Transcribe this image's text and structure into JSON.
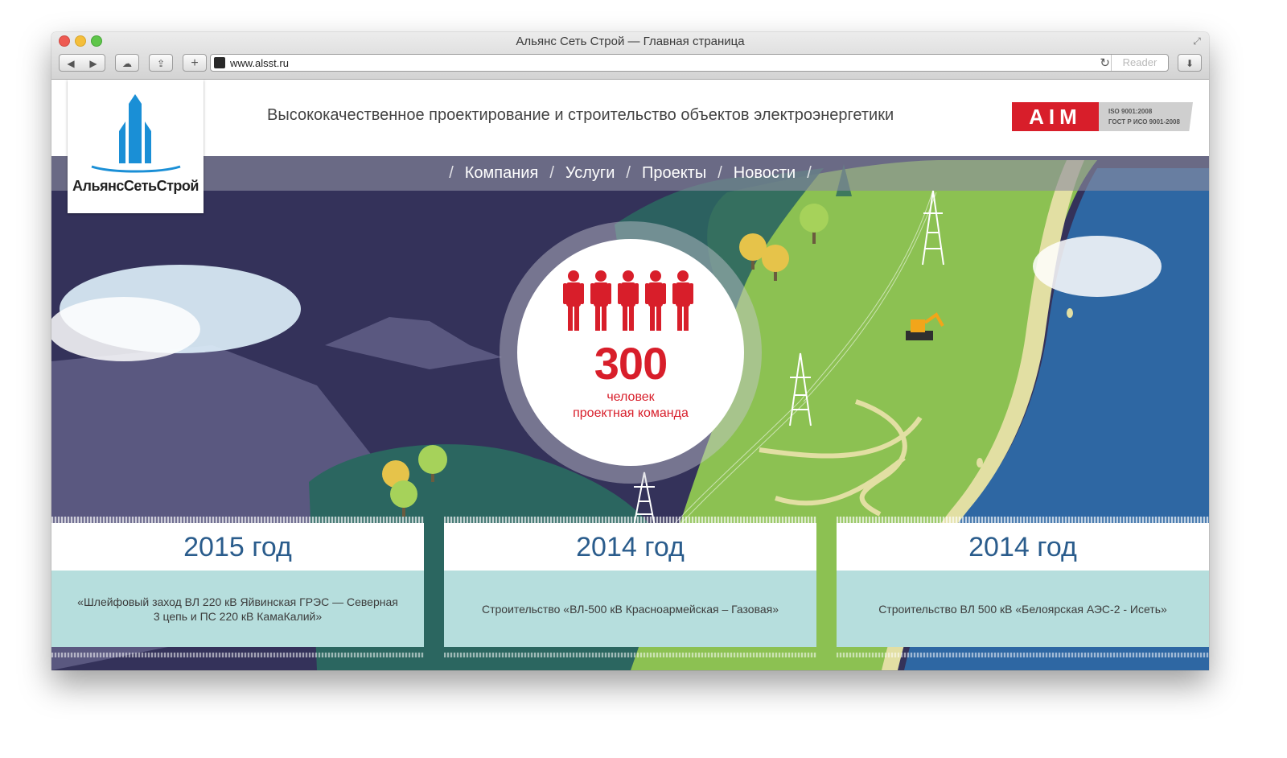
{
  "browser": {
    "window_title": "Альянс Сеть Строй — Главная страница",
    "url": "www.alsst.ru",
    "reader_label": "Reader",
    "back_glyph": "◀",
    "forward_glyph": "▶",
    "cloud_glyph": "☁",
    "share_glyph": "⇪",
    "new_tab_glyph": "+",
    "reload_glyph": "↻",
    "download_glyph": "⬇",
    "fullscreen_glyph": "⤢"
  },
  "header": {
    "logo_text": "АльянсСетьСтрой",
    "tagline": "Высококачественное проектирование и строительство объектов электроэнергетики",
    "cert": {
      "brand": "AIM",
      "line1": "ISO 9001:2008",
      "line2": "ГОСТ Р ИСО 9001-2008"
    }
  },
  "nav": {
    "separator": "/",
    "items": [
      {
        "label": "Компания"
      },
      {
        "label": "Услуги"
      },
      {
        "label": "Проекты"
      },
      {
        "label": "Новости"
      }
    ]
  },
  "stat": {
    "value": "300",
    "line1": "человек",
    "line2": "проектная команда",
    "worker_count": 5
  },
  "cards": [
    {
      "year": "2015 год",
      "text": "«Шлейфовый заход ВЛ 220 кВ Яйвинская ГРЭС — Северная 3 цепь и ПС 220 кВ КамаКалий»"
    },
    {
      "year": "2014 год",
      "text": "Строительство «ВЛ-500 кВ Красноармейская – Газовая»"
    },
    {
      "year": "2014 год",
      "text": "Строительство ВЛ 500 кВ «Белоярская АЭС-2 - Исеть»"
    }
  ],
  "colors": {
    "brand_red": "#d81e2a",
    "brand_blue": "#2a5c8c",
    "logo_blue": "#1a8fd6",
    "card_teal": "#b6dedd",
    "night_sky": "#34325a",
    "grass": "#8cc152",
    "sea": "#2e67a3"
  }
}
